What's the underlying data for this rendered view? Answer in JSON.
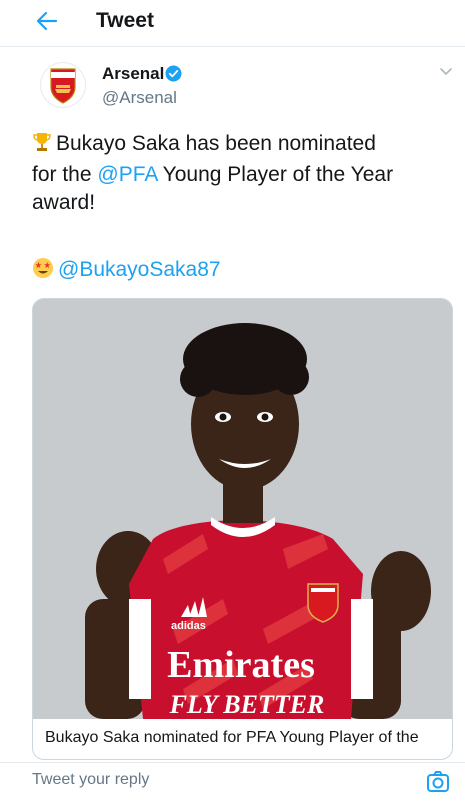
{
  "header": {
    "title": "Tweet",
    "back_icon": "arrow-left-icon"
  },
  "tweet": {
    "author_name": "Arsenal",
    "author_handle": "@Arsenal",
    "verified": true,
    "line1": "Bukayo Saka has been nominated",
    "line2_prefix": "for the ",
    "line2_mention": "@PFA",
    "line2_suffix": " Young Player of the Year",
    "line3": "award!",
    "mention_player": "@BukayoSaka87",
    "emoji_trophy": "trophy-icon",
    "emoji_starstruck": "star-struck-icon"
  },
  "card": {
    "title": "Bukayo Saka nominated for PFA Young Player of the",
    "shirt_sponsor_line1": "Emirates",
    "shirt_sponsor_line2": "FLY BETTER",
    "shirt_brand": "adidas"
  },
  "reply": {
    "placeholder": "Tweet your reply",
    "camera_icon": "camera-icon"
  },
  "colors": {
    "accent": "#1da1f2",
    "arsenal_red": "#d81920",
    "text": "#14171a",
    "muted": "#657786"
  }
}
